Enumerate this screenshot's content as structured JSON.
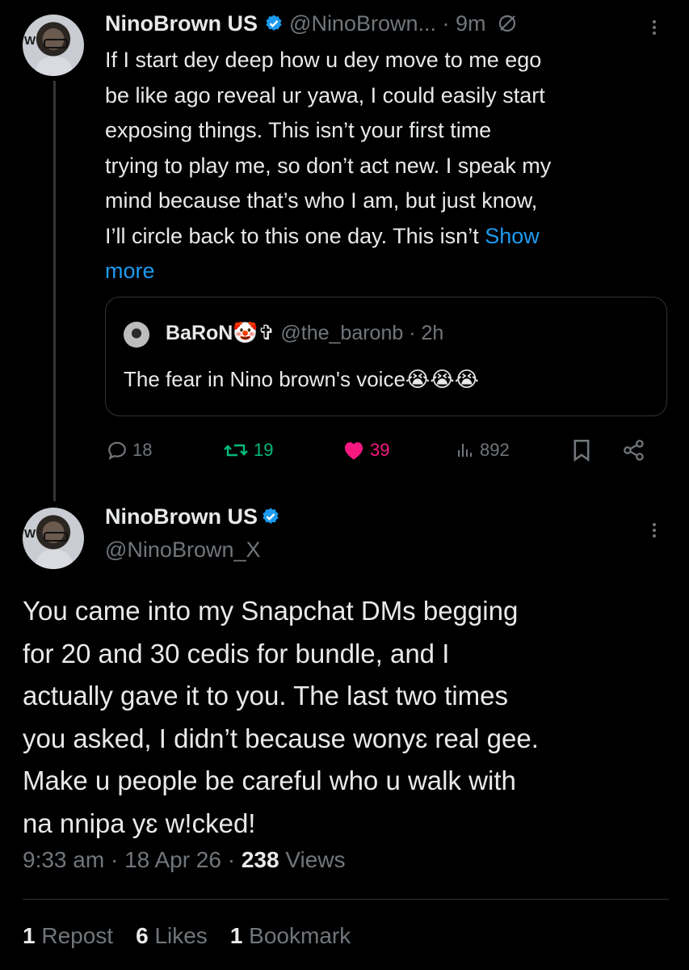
{
  "reply_tweet": {
    "display_name": "NinoBrown US",
    "handle": "@NinoBrown...",
    "time": "· 9m",
    "text_lines": [
      "If I start dey deep how u dey move to me ego",
      "be like ago reveal ur yawa, I could easily start",
      "exposing things. This isn’t your first time",
      "trying to play me, so don’t act new. I speak my",
      "mind because that’s who I am, but just know,",
      "I’ll circle back to this one day. This isn’t"
    ],
    "show_more_1": "Show",
    "show_more_2": "more",
    "quote": {
      "display_name": "BaRoN🤡✞",
      "handle": "@the_baronb",
      "time": "· 2h",
      "text": "The fear in Nino brown's voice😭😭😭"
    },
    "actions": {
      "replies": "18",
      "reposts": "19",
      "likes": "39",
      "views": "892"
    }
  },
  "main_tweet": {
    "display_name": "NinoBrown US",
    "handle": "@NinoBrown_X",
    "text_lines": [
      "You came into my Snapchat DMs begging",
      "for 20 and 30 cedis for bundle, and I",
      "actually gave it to you. The last two times",
      "you asked, I didn’t because wonyɛ real gee.",
      "Make u people be careful who u walk with",
      "na nnipa yɛ w!cked!"
    ],
    "time": "9:33 am",
    "date": "18 Apr 26",
    "views_count": "238",
    "views_label": "Views",
    "reposts_count": "1",
    "reposts_label": "Repost",
    "likes_count": "6",
    "likes_label": "Likes",
    "bookmarks_count": "1",
    "bookmarks_label": "Bookmark"
  },
  "colors": {
    "background": "#000000",
    "text": "#e7e9ea",
    "muted": "#71767b",
    "link": "#1d9bf0",
    "repost_green": "#00ba7c",
    "like_pink": "#f91880",
    "verified_blue": "#1d9bf0"
  }
}
